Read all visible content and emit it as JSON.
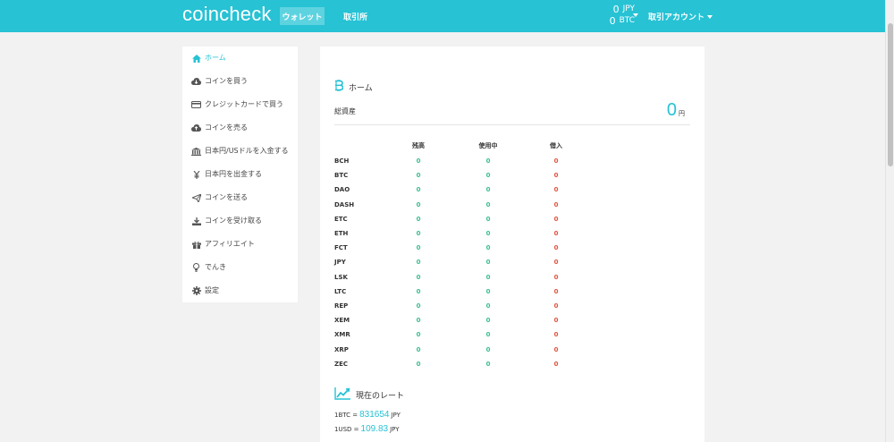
{
  "header": {
    "logo": "coincheck",
    "nav": {
      "wallet": "ウォレット",
      "exchange": "取引所"
    },
    "balance": [
      {
        "value": "0",
        "unit": "JPY"
      },
      {
        "value": "0",
        "unit": "BTC"
      }
    ],
    "account": "取引アカウント"
  },
  "sidebar": {
    "items": [
      {
        "label": "ホーム",
        "icon": "home-icon"
      },
      {
        "label": "コインを買う",
        "icon": "cloud-download-icon"
      },
      {
        "label": "クレジットカードで買う",
        "icon": "credit-card-icon"
      },
      {
        "label": "コインを売る",
        "icon": "cloud-upload-icon"
      },
      {
        "label": "日本円/USドルを入金する",
        "icon": "bank-icon"
      },
      {
        "label": "日本円を出金する",
        "icon": "yen-icon"
      },
      {
        "label": "コインを送る",
        "icon": "paper-plane-icon"
      },
      {
        "label": "コインを受け取る",
        "icon": "download-icon"
      },
      {
        "label": "アフィリエイト",
        "icon": "gift-icon"
      },
      {
        "label": "でんき",
        "icon": "lightbulb-icon"
      },
      {
        "label": "設定",
        "icon": "gear-icon"
      }
    ]
  },
  "main": {
    "title": "ホーム",
    "assets_label": "総資産",
    "assets_value": "0",
    "assets_unit": "円",
    "columns": [
      "残高",
      "使用中",
      "借入"
    ],
    "rows": [
      {
        "currency": "BCH",
        "balance": "0",
        "in_use": "0",
        "borrowed": "0"
      },
      {
        "currency": "BTC",
        "balance": "0",
        "in_use": "0",
        "borrowed": "0"
      },
      {
        "currency": "DAO",
        "balance": "0",
        "in_use": "0",
        "borrowed": "0"
      },
      {
        "currency": "DASH",
        "balance": "0",
        "in_use": "0",
        "borrowed": "0"
      },
      {
        "currency": "ETC",
        "balance": "0",
        "in_use": "0",
        "borrowed": "0"
      },
      {
        "currency": "ETH",
        "balance": "0",
        "in_use": "0",
        "borrowed": "0"
      },
      {
        "currency": "FCT",
        "balance": "0",
        "in_use": "0",
        "borrowed": "0"
      },
      {
        "currency": "JPY",
        "balance": "0",
        "in_use": "0",
        "borrowed": "0"
      },
      {
        "currency": "LSK",
        "balance": "0",
        "in_use": "0",
        "borrowed": "0"
      },
      {
        "currency": "LTC",
        "balance": "0",
        "in_use": "0",
        "borrowed": "0"
      },
      {
        "currency": "REP",
        "balance": "0",
        "in_use": "0",
        "borrowed": "0"
      },
      {
        "currency": "XEM",
        "balance": "0",
        "in_use": "0",
        "borrowed": "0"
      },
      {
        "currency": "XMR",
        "balance": "0",
        "in_use": "0",
        "borrowed": "0"
      },
      {
        "currency": "XRP",
        "balance": "0",
        "in_use": "0",
        "borrowed": "0"
      },
      {
        "currency": "ZEC",
        "balance": "0",
        "in_use": "0",
        "borrowed": "0"
      }
    ],
    "rates_title": "現在のレート",
    "rates": [
      {
        "pair": "1BTC =",
        "value": "831654",
        "unit": "JPY"
      },
      {
        "pair": "1USD =",
        "value": "109.83",
        "unit": "JPY"
      }
    ]
  },
  "colors": {
    "accent": "#27c2d4",
    "positive": "#3bbf8f",
    "negative": "#e0543f",
    "background": "#f2f2f2"
  }
}
